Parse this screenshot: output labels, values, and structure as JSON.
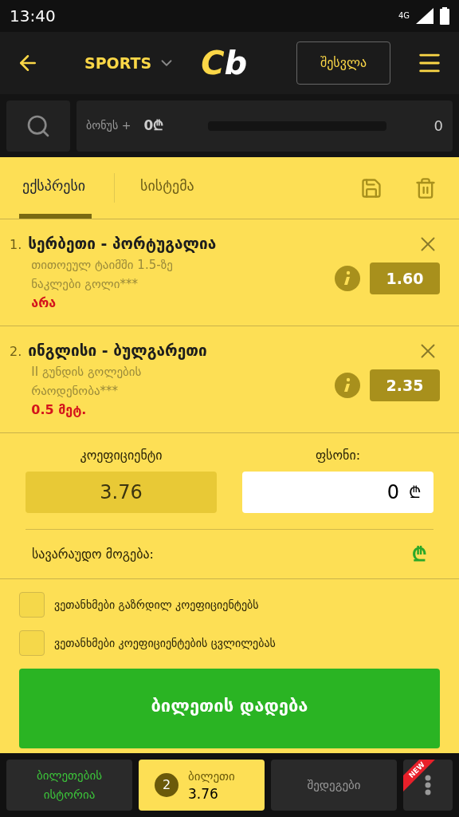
{
  "status_bar": {
    "time": "13:40",
    "network": "4G"
  },
  "header": {
    "section": "SPORTS",
    "logo": [
      {
        "text": "C",
        "color": "#fbd747"
      },
      {
        "text": "b",
        "color": "#ffffff"
      }
    ],
    "login": "შესვლა"
  },
  "bonus": {
    "label": "ბონუს +",
    "amount": "0₾",
    "level": 0,
    "count": "0"
  },
  "tabs": [
    {
      "label": "ექსპრესი",
      "selected": true
    },
    {
      "label": "სისტემა",
      "selected": false
    }
  ],
  "bets": [
    {
      "number": "1.",
      "match": "სერბეთი - პორტუგალია",
      "market": "თითოეულ ტაიმში 1.5-ზე ნაკლები გოლი***",
      "pick": "არა",
      "odds": "1.60"
    },
    {
      "number": "2.",
      "match": "ინგლისი - ბულგარეთი",
      "market": "II გუნდის გოლების რაოდენობა***",
      "pick": "0.5 მეტ.",
      "odds": "2.35"
    }
  ],
  "summary": {
    "odds_label": "კოეფიციენტი",
    "odds_value": "3.76",
    "stake_label": "ფსონი:",
    "stake_value": "0",
    "stake_currency": "₾",
    "potential_label": "სავარაუდო მოგება:",
    "potential_currency": "₾"
  },
  "options": [
    {
      "label": "ვეთანხმები გაზრდილ კოეფიციენტებს",
      "checked": false
    },
    {
      "label": "ვეთანხმები კოეფიციენტების ცვლილებას",
      "checked": false
    }
  ],
  "place_button": "ბილეთის დადება",
  "bottom_nav": [
    {
      "kind": "history",
      "label": "ბილეთების ისტორია",
      "selected": false
    },
    {
      "kind": "slip",
      "count": "2",
      "label": "ბილეთი",
      "value": "3.76",
      "selected": true
    },
    {
      "kind": "results",
      "label": "შედეგები",
      "selected": false
    },
    {
      "kind": "more",
      "badge": "NEW",
      "selected": false
    }
  ]
}
